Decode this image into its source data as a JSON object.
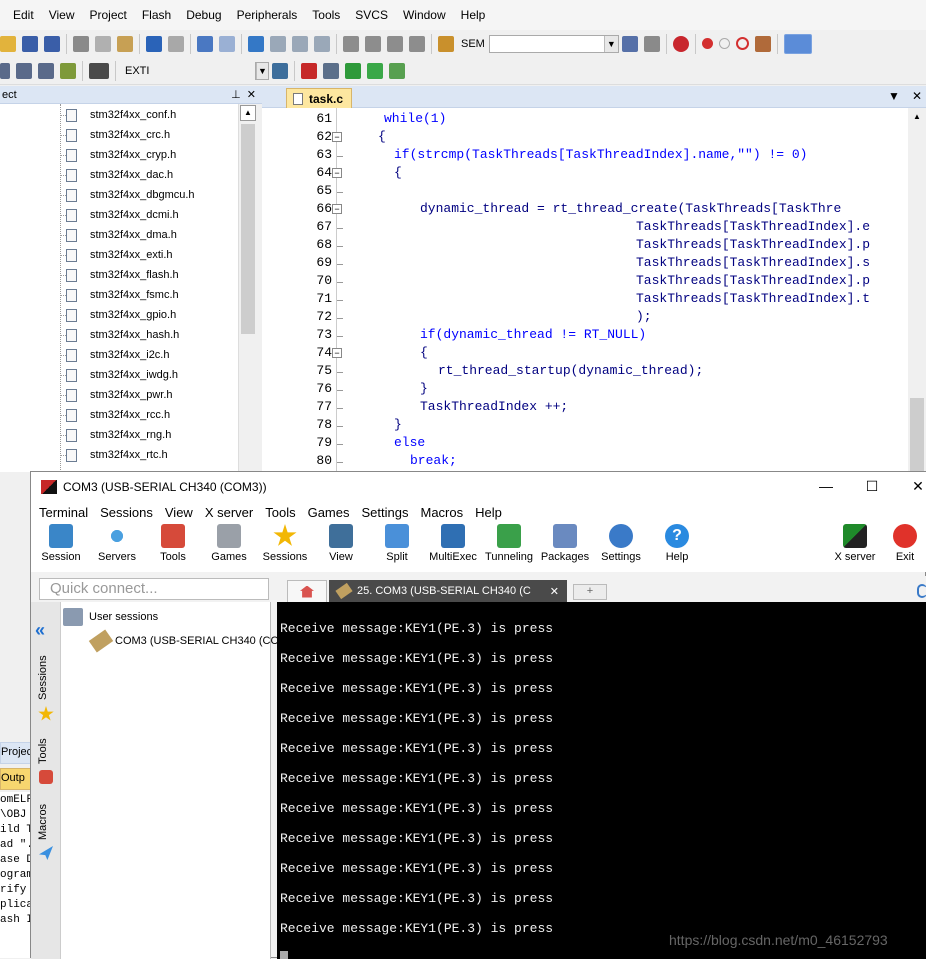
{
  "keil": {
    "menu": [
      "Edit",
      "View",
      "Project",
      "Flash",
      "Debug",
      "Peripherals",
      "Tools",
      "SVCS",
      "Window",
      "Help"
    ],
    "toolbar_combo1": "SEM",
    "toolbar_combo2": "EXTI",
    "project_header": "ect",
    "project_files": [
      "stm32f4xx_conf.h",
      "stm32f4xx_crc.h",
      "stm32f4xx_cryp.h",
      "stm32f4xx_dac.h",
      "stm32f4xx_dbgmcu.h",
      "stm32f4xx_dcmi.h",
      "stm32f4xx_dma.h",
      "stm32f4xx_exti.h",
      "stm32f4xx_flash.h",
      "stm32f4xx_fsmc.h",
      "stm32f4xx_gpio.h",
      "stm32f4xx_hash.h",
      "stm32f4xx_i2c.h",
      "stm32f4xx_iwdg.h",
      "stm32f4xx_pwr.h",
      "stm32f4xx_rcc.h",
      "stm32f4xx_rng.h",
      "stm32f4xx_rtc.h"
    ],
    "editor_tab": "task.c",
    "line_numbers": [
      "61",
      "62",
      "63",
      "64",
      "65",
      "66",
      "67",
      "68",
      "69",
      "70",
      "71",
      "72",
      "73",
      "74",
      "75",
      "76",
      "77",
      "78",
      "79",
      "80"
    ],
    "code_lines": [
      "while(1)",
      "{",
      "if(strcmp(TaskThreads[TaskThreadIndex].name,\"\") != 0)",
      "{",
      "",
      "dynamic_thread = rt_thread_create(TaskThreads[TaskThre",
      "TaskThreads[TaskThreadIndex].e",
      "TaskThreads[TaskThreadIndex].p",
      "TaskThreads[TaskThreadIndex].s",
      "TaskThreads[TaskThreadIndex].p",
      "TaskThreads[TaskThreadIndex].t",
      ");",
      "if(dynamic_thread != RT_NULL)",
      "{",
      "rt_thread_startup(dynamic_thread);",
      "}",
      "TaskThreadIndex ++;",
      "}",
      "else",
      "break;"
    ],
    "bottom_tabs": [
      "Project",
      "Outp"
    ],
    "build_output": [
      "omELF",
      "\\OBJ",
      "ild T",
      "ad \".",
      "ase D",
      "ogram",
      "rify ",
      "plica",
      "ash I"
    ]
  },
  "moba": {
    "title": "COM3  (USB-SERIAL CH340 (COM3))",
    "menu": [
      "Terminal",
      "Sessions",
      "View",
      "X server",
      "Tools",
      "Games",
      "Settings",
      "Macros",
      "Help"
    ],
    "tools": [
      "Session",
      "Servers",
      "Tools",
      "Games",
      "Sessions",
      "View",
      "Split",
      "MultiExec",
      "Tunneling",
      "Packages",
      "Settings",
      "Help"
    ],
    "xserver": "X server",
    "exit": "Exit",
    "quick_connect_placeholder": "Quick connect...",
    "side_tabs": [
      "Sessions",
      "Tools",
      "Macros"
    ],
    "sessions_root": "User sessions",
    "session_item": "COM3  (USB-SERIAL CH340 (CC",
    "active_tab": "25. COM3  (USB-SERIAL CH340 (C",
    "terminal_lines": [
      "Receive message:KEY1(PE.3) is press",
      "Receive message:KEY1(PE.3) is press",
      "Receive message:KEY1(PE.3) is press",
      "Receive message:KEY1(PE.3) is press",
      "Receive message:KEY1(PE.3) is press",
      "Receive message:KEY1(PE.3) is press",
      "Receive message:KEY1(PE.3) is press",
      "Receive message:KEY1(PE.3) is press",
      "Receive message:KEY1(PE.3) is press",
      "Receive message:KEY1(PE.3) is press",
      "Receive message:KEY1(PE.3) is press"
    ]
  },
  "watermark": "https://blog.csdn.net/m0_46152793"
}
